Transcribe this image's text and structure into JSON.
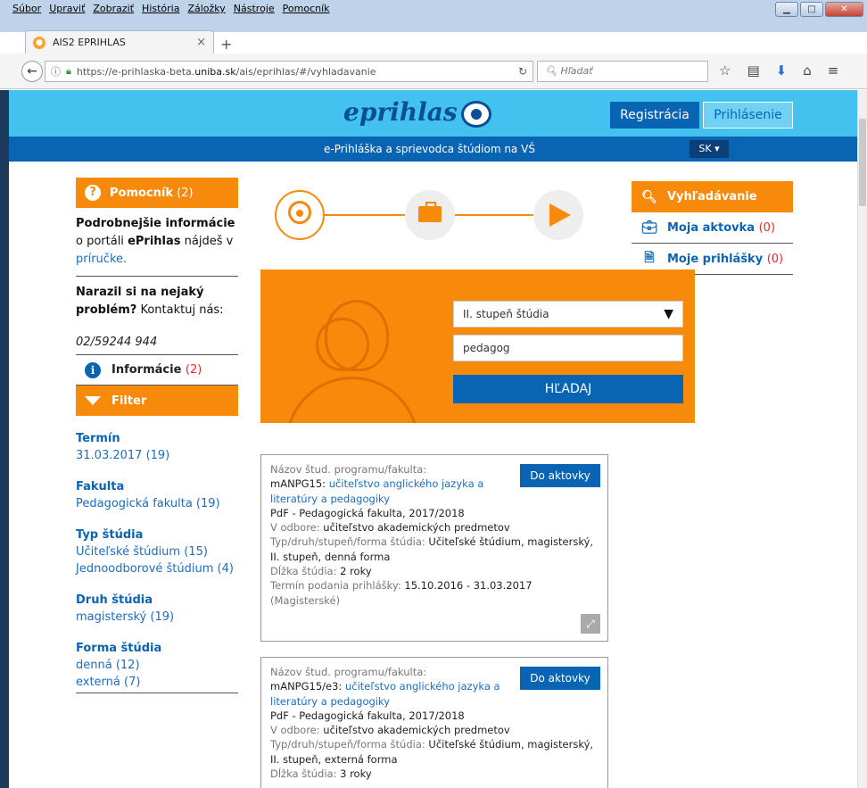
{
  "browser": {
    "menu": [
      "Súbor",
      "Upraviť",
      "Zobraziť",
      "História",
      "Záložky",
      "Nástroje",
      "Pomocník"
    ],
    "tab_title": "AIS2 EPRIHLAS",
    "url_prefix": "https://e-prihlaska-beta.",
    "url_domain": "uniba.sk",
    "url_suffix": "/ais/eprihlas/#/vyhladavanie",
    "search_placeholder": "Hľadať"
  },
  "site": {
    "logo": "eprihlas",
    "register": "Registrácia",
    "login": "Prihlásenie",
    "subtitle": "e-Prihláška a sprievodca štúdiom na VŠ",
    "lang": "SK ▾"
  },
  "sidebar": {
    "helper_label": "Pomocník",
    "helper_count": "(2)",
    "info_bold": "Podrobnejšie informácie",
    "info_mid": " o portáli ",
    "info_brand": "ePrihlas",
    "info_tail": " nájdeš v ",
    "info_link": "príručke.",
    "problem_bold": "Narazil si na nejaký problém?",
    "problem_tail": " Kontaktuj nás:",
    "phone": "02/59244 944",
    "informacie_label": "Informácie",
    "informacie_count": "(2)",
    "filter_label": "Filter",
    "filters": [
      {
        "title": "Termín",
        "values": [
          "31.03.2017  (19)"
        ]
      },
      {
        "title": "Fakulta",
        "values": [
          "Pedagogická fakulta  (19)"
        ]
      },
      {
        "title": "Typ štúdia",
        "values": [
          "Učiteľské štúdium  (15)",
          "Jednoodborové štúdium  (4)"
        ]
      },
      {
        "title": "Druh štúdia",
        "values": [
          "magisterský  (19)"
        ]
      },
      {
        "title": "Forma štúdia",
        "values": [
          "denná  (12)",
          "externá  (7)"
        ]
      }
    ]
  },
  "rightnav": {
    "search": "Vyhľadávanie",
    "bag": "Moja aktovka",
    "bag_count": "(0)",
    "apps": "Moje prihlášky",
    "apps_count": "(0)"
  },
  "search": {
    "level": "II. stupeň štúdia",
    "query": "pedagog",
    "button": "HĽADAJ"
  },
  "results": [
    {
      "label": "Názov štud. programu/fakulta:",
      "code": "mANPG15: ",
      "name_a": "učiteľstvo anglického jazyka a",
      "name_b": "literatúry a pedagogiky",
      "faculty": "PdF - Pedagogická fakulta, 2017/2018",
      "field_label": "V odbore: ",
      "field": "učiteľstvo akademických predmetov",
      "type_label": "Typ/druh/stupeň/forma štúdia: ",
      "type_a": "Učiteľské štúdium, magisterský,",
      "type_b": "II. stupeň, denná forma",
      "len_label": "Dĺžka štúdia: ",
      "len": "2 roky",
      "deadline_label": "Termín podania prihlášky: ",
      "deadline": "15.10.2016 - 31.03.2017",
      "deadline_note": "(Magisterské)",
      "button": "Do aktovky"
    },
    {
      "label": "Názov štud. programu/fakulta:",
      "code": "mANPG15/e3: ",
      "name_a": "učiteľstvo anglického jazyka a",
      "name_b": "literatúry a pedagogiky",
      "faculty": "PdF - Pedagogická fakulta, 2017/2018",
      "field_label": "V odbore: ",
      "field": "učiteľstvo akademických predmetov",
      "type_label": "Typ/druh/stupeň/forma štúdia: ",
      "type_a": "Učiteľské štúdium, magisterský,",
      "type_b": "II. stupeň, externá forma",
      "len_label": "Dĺžka štúdia: ",
      "len": "3 roky",
      "button": "Do aktovky"
    }
  ],
  "colors": {
    "orange": "#f7890b",
    "blue": "#0a64b4",
    "cyan": "#42c3ef",
    "red": "#e8262c"
  }
}
